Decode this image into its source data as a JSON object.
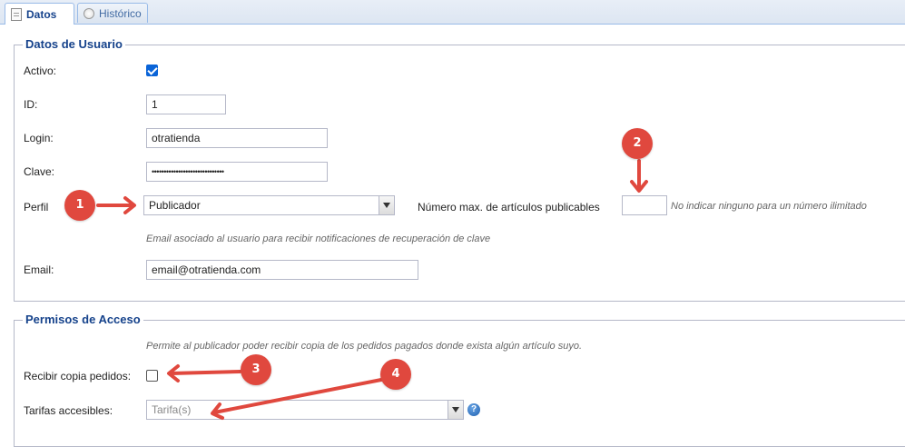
{
  "tabs": [
    {
      "label": "Datos",
      "icon": "document-icon",
      "active": true
    },
    {
      "label": "Histórico",
      "icon": "clock-icon",
      "active": false
    }
  ],
  "user_section": {
    "legend": "Datos de Usuario",
    "activo_label": "Activo:",
    "activo_checked": true,
    "id_label": "ID:",
    "id_value": "1",
    "login_label": "Login:",
    "login_value": "otratienda",
    "clave_label": "Clave:",
    "clave_value": "••••••••••••••••••••••••••••••",
    "perfil_label": "Perfil",
    "perfil_value": "Publicador",
    "max_label": "Número max. de artículos publicables",
    "max_value": "",
    "max_hint": "No indicar ninguno para un número ilimitado",
    "email_hint": "Email asociado al usuario para recibir notificaciones de recuperación de clave",
    "email_label": "Email:",
    "email_value": "email@otratienda.com"
  },
  "access_section": {
    "legend": "Permisos de Acceso",
    "hint": "Permite al publicador poder recibir copia de los pedidos pagados donde exista algún artículo suyo.",
    "copia_label": "Recibir copia pedidos:",
    "copia_checked": false,
    "tarifas_label": "Tarifas accesibles:",
    "tarifas_placeholder": "Tarifa(s)",
    "help_glyph": "?"
  },
  "annotations": {
    "color": "#e0483e",
    "markers": [
      "1",
      "2",
      "3",
      "4"
    ]
  }
}
